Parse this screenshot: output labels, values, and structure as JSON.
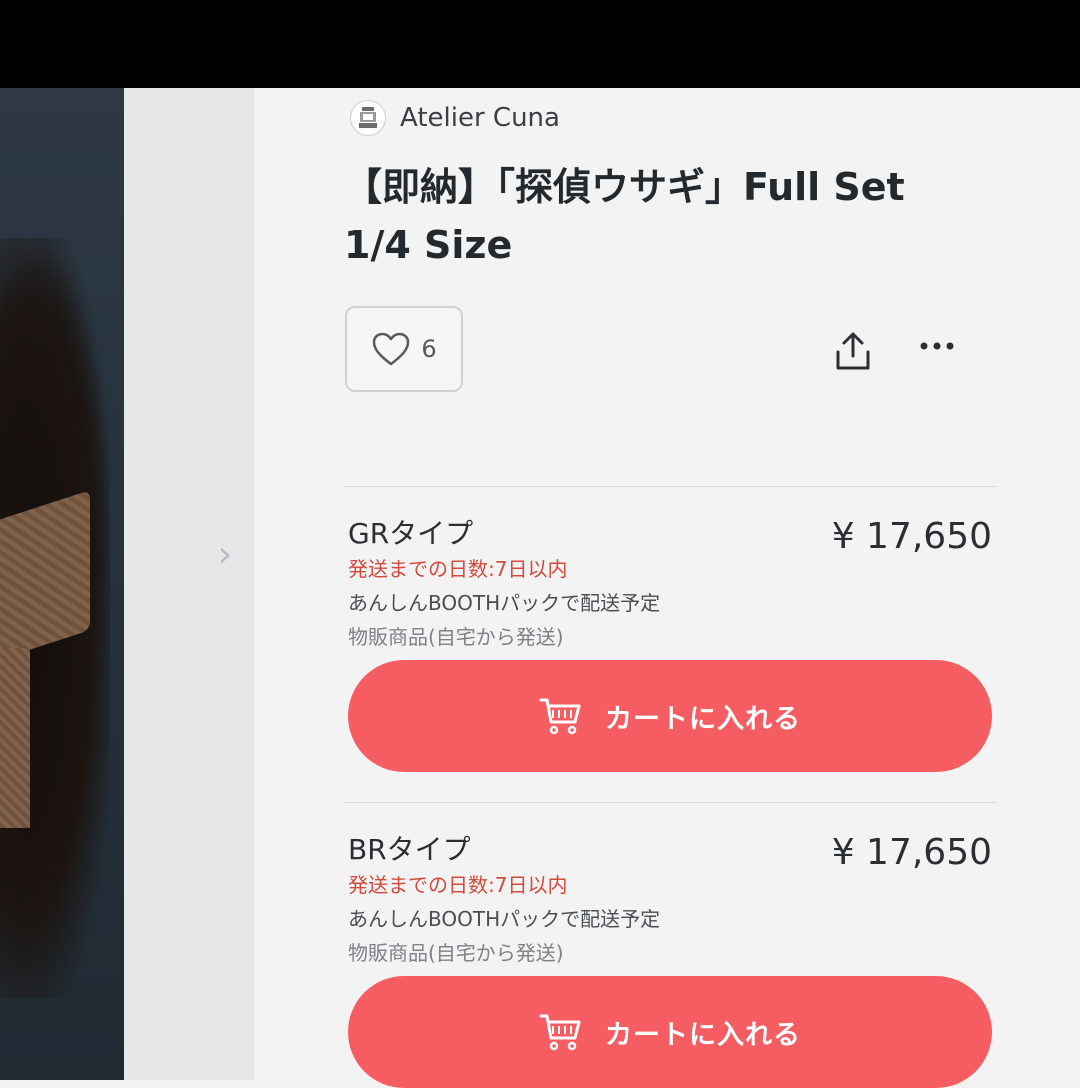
{
  "shop": {
    "name": "Atelier Cuna"
  },
  "product": {
    "title_line1": "【即納】「探偵ウサギ」Full Set",
    "title_line2": "1/4 Size"
  },
  "actions": {
    "like_count": "6"
  },
  "variants": [
    {
      "name": "GRタイプ",
      "price": "¥ 17,650",
      "ship_days": "発送までの日数:7日以内",
      "pack": "あんしんBOOTHパックで配送予定",
      "type_note": "物販商品(自宅から発送)",
      "cart_label": "カートに入れる"
    },
    {
      "name": "BRタイプ",
      "price": "¥ 17,650",
      "ship_days": "発送までの日数:7日以内",
      "pack": "あんしんBOOTHパックで配送予定",
      "type_note": "物販商品(自宅から発送)",
      "cart_label": "カートに入れる"
    }
  ],
  "colors": {
    "accent": "#f65d62",
    "ship_days": "#d24b3c",
    "text": "#2b2f33"
  },
  "icons": [
    "heart-icon",
    "share-icon",
    "more-icon",
    "cart-icon",
    "chevron-right-icon",
    "shop-logo-icon"
  ]
}
